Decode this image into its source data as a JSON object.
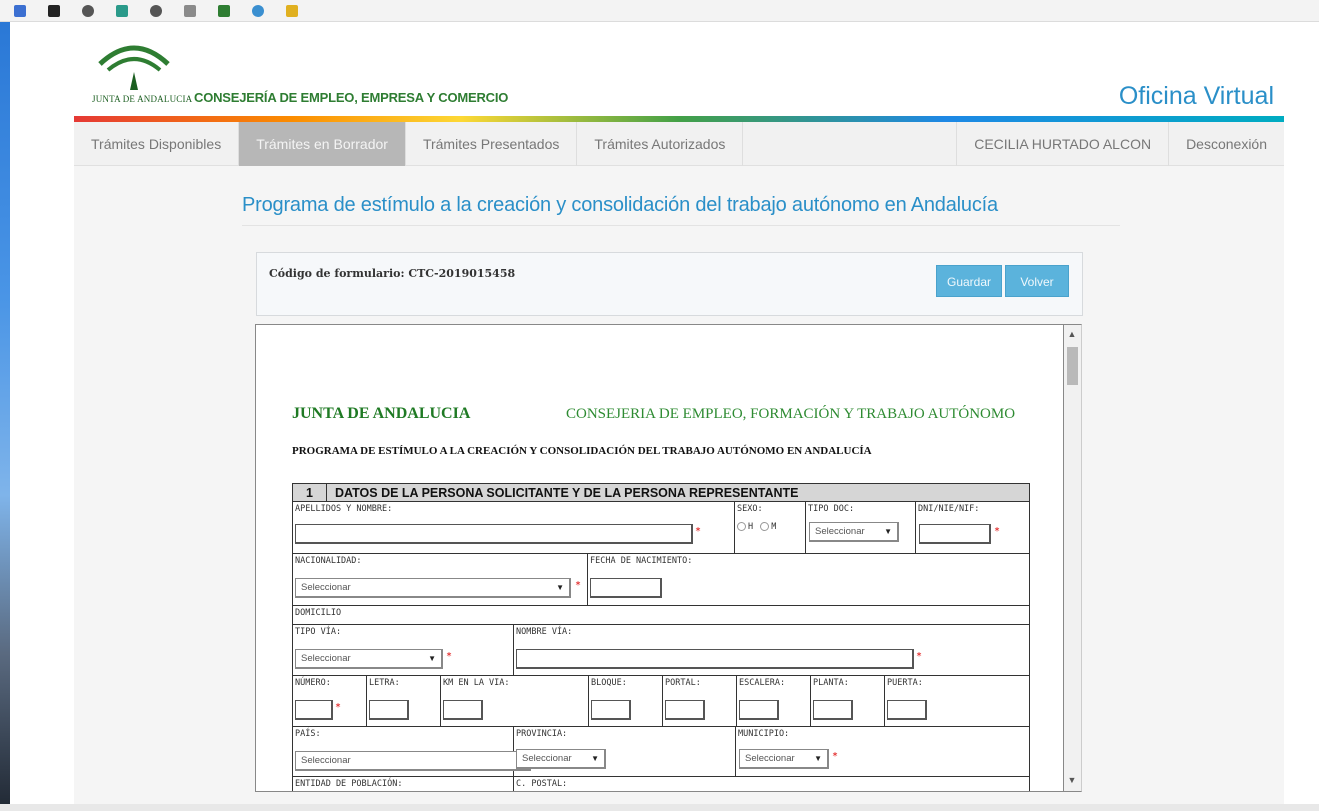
{
  "header": {
    "logo_text": "JUNTA DE ANDALUCIA",
    "consejeria": "CONSEJERÍA DE EMPLEO, EMPRESA Y COMERCIO",
    "oficina": "Oficina Virtual"
  },
  "nav": {
    "items": [
      "Trámites Disponibles",
      "Trámites en Borrador",
      "Trámites Presentados",
      "Trámites Autorizados"
    ],
    "active": "Trámites en Borrador",
    "user": "CECILIA HURTADO ALCON",
    "logout": "Desconexión"
  },
  "page_title": "Programa de estímulo a la creación y consolidación del trabajo autónomo en Andalucía",
  "form_code": {
    "label": "Código de formulario: CTC-2019015458"
  },
  "buttons": {
    "guardar": "Guardar",
    "volver": "Volver"
  },
  "pdf": {
    "junta": "JUNTA DE ANDALUCIA",
    "consejeria": "CONSEJERIA DE EMPLEO, FORMACIÓN Y TRABAJO AUTÓNOMO",
    "programa": "PROGRAMA DE ESTÍMULO A LA CREACIÓN Y CONSOLIDACIÓN DEL TRABAJO AUTÓNOMO EN ANDALUCÍA",
    "section_num": "1",
    "section_title": "DATOS DE LA PERSONA SOLICITANTE Y DE LA PERSONA REPRESENTANTE",
    "labels": {
      "apellidos": "APELLIDOS Y NOMBRE:",
      "sexo": "SEXO:",
      "sexo_h": "H",
      "sexo_m": "M",
      "tipo_doc": "TIPO DOC:",
      "dni": "DNI/NIE/NIF:",
      "nacionalidad": "NACIONALIDAD:",
      "fecha_nac": "FECHA DE NACIMIENTO:",
      "domicilio": "DOMICILIO",
      "tipo_via": "TIPO VÍA:",
      "nombre_via": "NOMBRE VÍA:",
      "numero": "NÚMERO:",
      "letra": "LETRA:",
      "km": "KM EN LA VIA:",
      "bloque": "BLOQUE:",
      "portal": "PORTAL:",
      "escalera": "ESCALERA:",
      "planta": "PLANTA:",
      "puerta": "PUERTA:",
      "pais": "PAÍS:",
      "provincia": "PROVINCIA:",
      "municipio": "MUNICIPIO:",
      "entidad": "ENTIDAD DE POBLACIÓN:",
      "cpostal": "C. POSTAL:"
    },
    "select_placeholder": "Seleccionar"
  }
}
